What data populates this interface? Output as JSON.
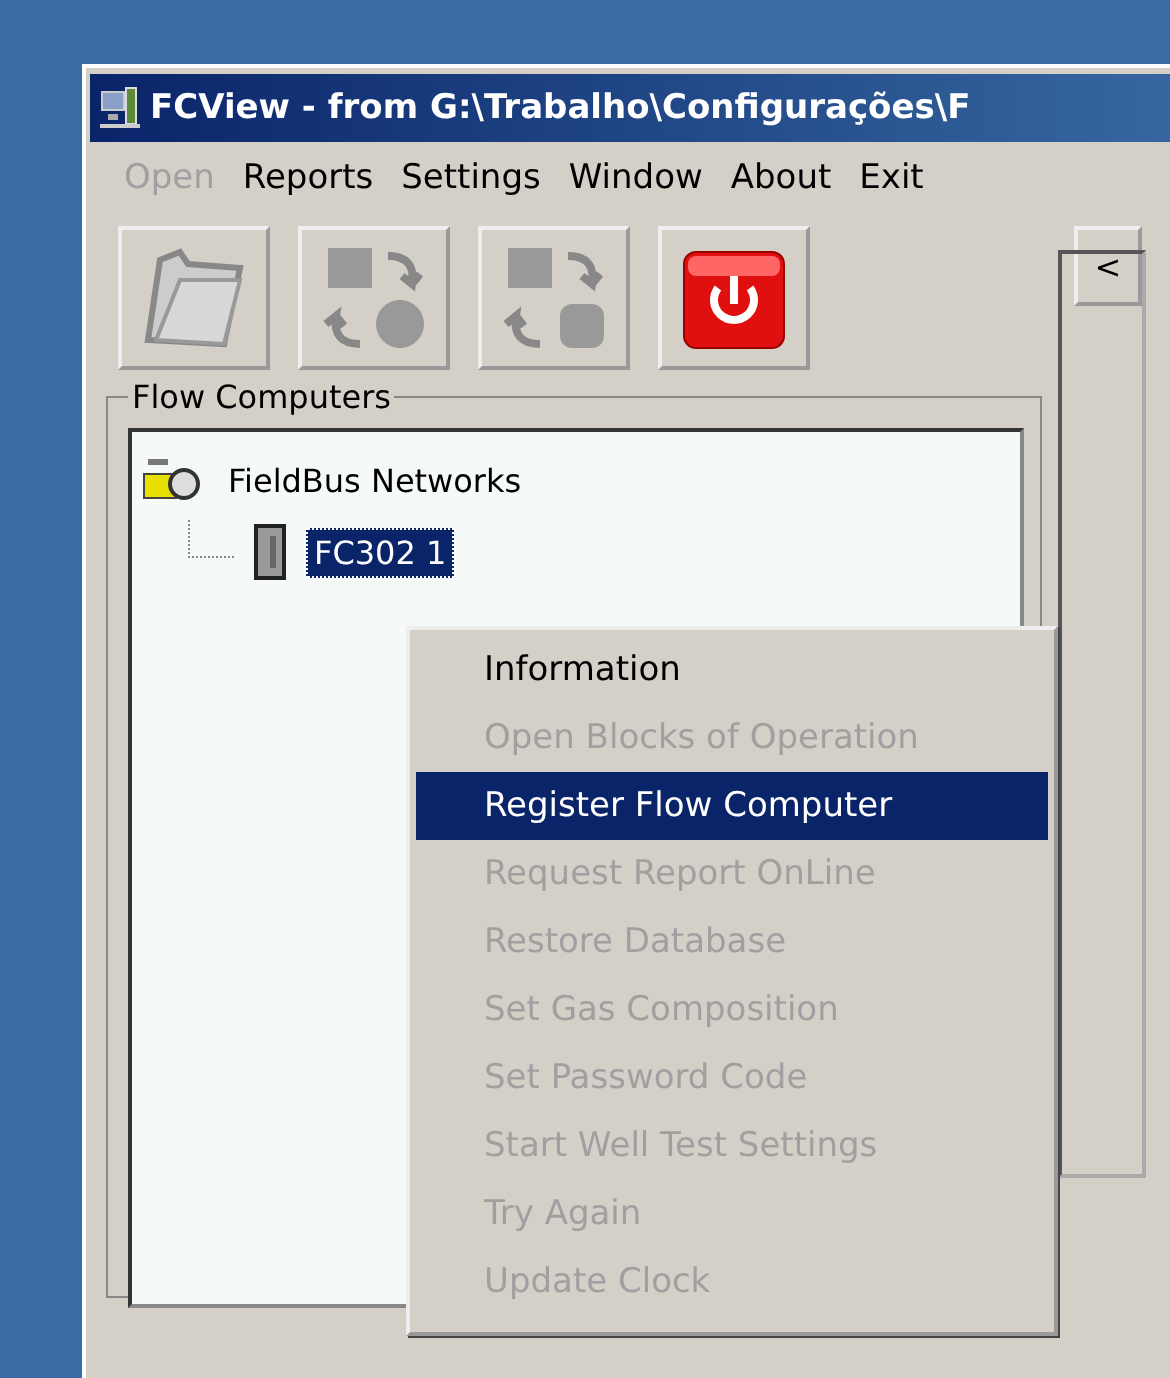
{
  "window": {
    "title": "FCView - from G:\\Trabalho\\Configurações\\F"
  },
  "menu_bar": [
    {
      "label": "Open",
      "disabled": true
    },
    {
      "label": "Reports",
      "disabled": false
    },
    {
      "label": "Settings",
      "disabled": false
    },
    {
      "label": "Window",
      "disabled": false
    },
    {
      "label": "About",
      "disabled": false
    },
    {
      "label": "Exit",
      "disabled": false
    }
  ],
  "toolbar": [
    {
      "kind": "folder"
    },
    {
      "kind": "transfer-globe"
    },
    {
      "kind": "transfer-database"
    },
    {
      "kind": "power"
    }
  ],
  "collapse_button": {
    "label": "<"
  },
  "group": {
    "title": "Flow Computers",
    "tree": [
      {
        "label": "FieldBus Networks",
        "selected": false,
        "children": [
          {
            "label": "FC302 1",
            "selected": true
          }
        ]
      }
    ]
  },
  "context_menu": [
    {
      "label": "Information",
      "disabled": false,
      "selected": false
    },
    {
      "label": "Open Blocks of Operation",
      "disabled": true,
      "selected": false
    },
    {
      "label": "Register Flow Computer",
      "disabled": false,
      "selected": true
    },
    {
      "label": "Request Report OnLine",
      "disabled": true,
      "selected": false
    },
    {
      "label": "Restore Database",
      "disabled": true,
      "selected": false
    },
    {
      "label": "Set Gas Composition",
      "disabled": true,
      "selected": false
    },
    {
      "label": "Set Password Code",
      "disabled": true,
      "selected": false
    },
    {
      "label": "Start Well Test Settings",
      "disabled": true,
      "selected": false
    },
    {
      "label": "Try Again",
      "disabled": true,
      "selected": false
    },
    {
      "label": "Update Clock",
      "disabled": true,
      "selected": false
    }
  ]
}
